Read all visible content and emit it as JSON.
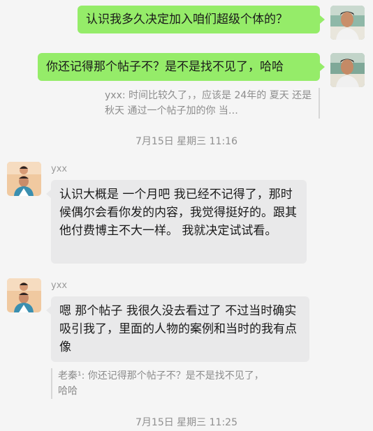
{
  "messages": [
    {
      "text": "认识我多久决定加入咱们超级个体的？"
    },
    {
      "text": "你还记得那个帖子不？是不是找不见了，哈哈",
      "quote": "yxx: 时间比较久了，，应该是 24年的 夏天 还是秋天   通过一个帖子加的你   当…"
    },
    {
      "sender": "yxx",
      "text": "认识大概是 一个月吧  我已经不记得了，那时候偶尔会看你发的内容，我觉得挺好的。跟其他付费博主不大一样。 我就决定试试看。"
    },
    {
      "sender": "yxx",
      "text": "嗯  那个帖子 我很久没去看过了 不过当时确实吸引我了，里面的人物的案例和当时的我有点像",
      "quote": "老秦¹: 你还记得那个帖子不？是不是找不见了，哈哈"
    }
  ],
  "timestamps": [
    "7月15日 星期三 11:16",
    "7月15日 星期三 11:25"
  ],
  "colors": {
    "outgoing_bubble": "#95ec69",
    "incoming_bubble": "#e9e9ea",
    "background": "#f5f5f5"
  },
  "icons": {
    "self_avatar": "avatar-photo",
    "contact_avatar": "avatar-photo"
  }
}
